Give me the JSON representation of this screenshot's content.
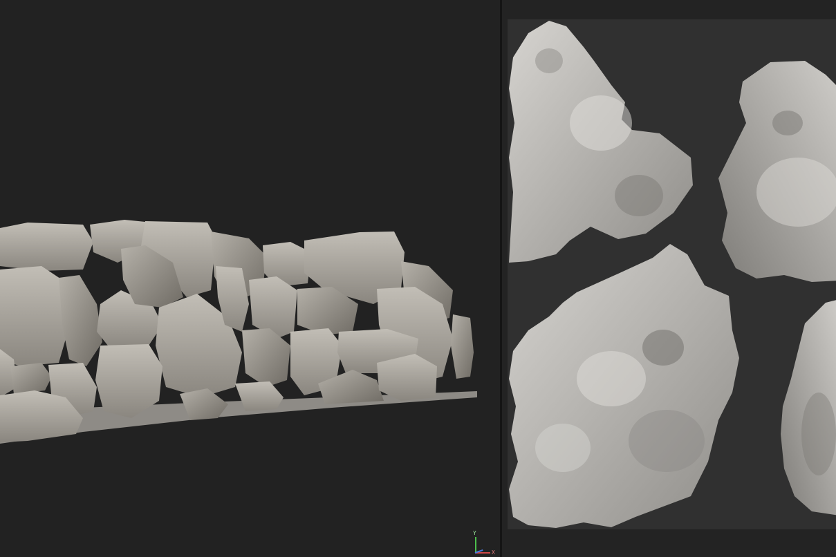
{
  "viewport_3d": {
    "axis_gizmo": {
      "y_label": "Y",
      "x_label": "X"
    },
    "colors": {
      "background": "#222222",
      "mesh": "#a8a49c",
      "mesh_shadow": "#6f6b64",
      "mesh_highlight": "#c8c4bc"
    }
  },
  "viewport_uv": {
    "colors": {
      "background": "#232323",
      "canvas": "#303030",
      "island": "#a9a7a3",
      "island_shadow": "#7a7874",
      "island_highlight": "#d6d4d0"
    },
    "islands": [
      "uv-island-top-left",
      "uv-island-top-right",
      "uv-island-bottom-center",
      "uv-island-bottom-right"
    ]
  }
}
